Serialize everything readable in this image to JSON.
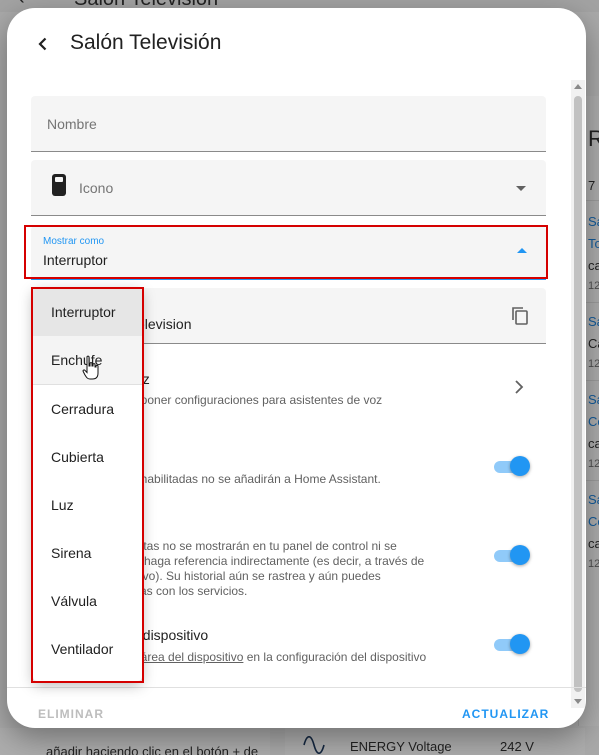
{
  "background": {
    "topbar_title": "Salón Televisión",
    "right_card": {
      "heading": "R",
      "count": "7",
      "items": [
        {
          "line1": "Sa",
          "line2": "To",
          "line3": "ca",
          "time": "12"
        },
        {
          "line1": "Sa",
          "line2": "Ca",
          "time": "12"
        },
        {
          "line1": "Sa",
          "line2": "Co",
          "line3": "ca",
          "time": "12"
        },
        {
          "line1": "Sa",
          "line2": "Co",
          "line3": "ca",
          "time": "12"
        }
      ]
    },
    "bottom_left_text": "añadir haciendo clic en el botón + de",
    "energy_row": {
      "name": "ENERGY Voltage",
      "value": "242 V"
    }
  },
  "dialog": {
    "title": "Salón Televisión",
    "fields": {
      "name_label": "Nombre",
      "icon_label": "Icono",
      "show_as_label": "Mostrar como",
      "show_as_value": "Interruptor",
      "entity_id_partial": "elevision"
    },
    "voice": {
      "title_partial": "voz",
      "desc_partial": "exponer configuraciones para asistentes de voz"
    },
    "disabled_row": {
      "desc_partial": "eshabilitadas no se añadirán a Home Assistant."
    },
    "hidden_row": {
      "desc_line1": "cultas no se mostrarán en tu panel de control ni se",
      "desc_line2": "se haga referencia indirectamente (es decir, a través de",
      "desc_line3": "sitivo). Su historial aún se rastrea y aún puedes",
      "desc_line4": "ellas con los servicios."
    },
    "area_row": {
      "title_partial": "el dispositivo",
      "link_text": "el área del dispositivo",
      "desc_rest": " en la configuración del dispositivo"
    },
    "buttons": {
      "delete": "ELIMINAR",
      "update": "ACTUALIZAR"
    }
  },
  "menu": {
    "options": [
      "Interruptor",
      "Enchufe",
      "Cerradura",
      "Cubierta",
      "Luz",
      "Sirena",
      "Válvula",
      "Ventilador"
    ],
    "selected": "Interruptor",
    "hovered": "Enchufe"
  },
  "colors": {
    "accent": "#2196f3",
    "highlight_box": "#d50000",
    "toggle_track": "#90caf9"
  },
  "icons": [
    "chevron-left-icon",
    "device-remote-icon",
    "chevron-down-icon",
    "chevron-up-icon",
    "copy-icon",
    "chevron-right-icon",
    "hand-pointer-icon",
    "energy-sine-icon"
  ]
}
